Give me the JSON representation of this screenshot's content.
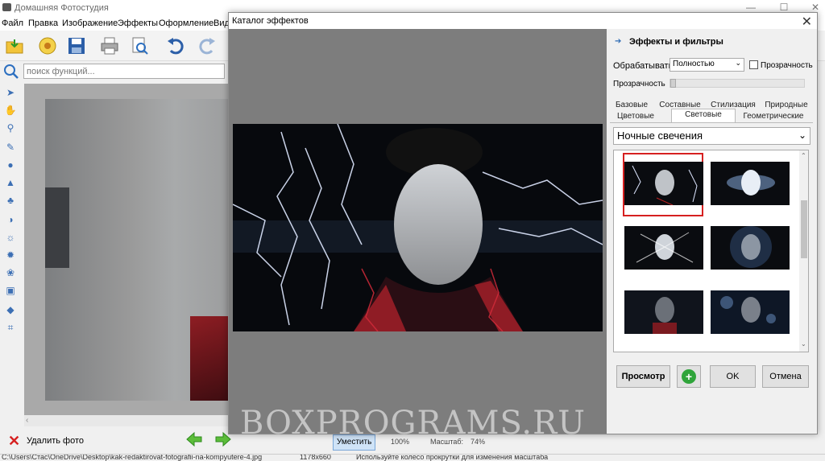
{
  "app": {
    "title": "Домашняя Фотостудия",
    "menu": [
      "Файл",
      "Правка",
      "Изображение",
      "Эффекты",
      "Оформление",
      "Вид"
    ],
    "search_placeholder": "поиск функций...",
    "delete_photo": "Удалить фото",
    "fit_label": "Уместить",
    "zoom_100": "100%",
    "scale_label": "Масштаб:",
    "scale_value": "74%"
  },
  "status": {
    "path": "C:\\Users\\Стас\\OneDrive\\Desktop\\kak-redaktirovat-fotografii-na-kompyutere-4.jpg",
    "size": "1178x660",
    "hint": "Используйте колесо прокрутки для изменения масштаба"
  },
  "dialog": {
    "title": "Каталог эффектов",
    "panel_title": "Эффекты и фильтры",
    "process_label": "Обрабатывать",
    "process_value": "Полностью",
    "transparency_checkbox": "Прозрачность",
    "transparency_slider_label": "Прозрачность",
    "tabs_row1": [
      "Базовые",
      "Составные",
      "Стилизация",
      "Природные"
    ],
    "tabs_row2": [
      "Цветовые",
      "Световые",
      "Геометрические"
    ],
    "active_tab": "Световые",
    "effect_value": "Ночные свечения",
    "preview_button": "Просмотр",
    "ok_button": "OK",
    "cancel_button": "Отмена"
  },
  "watermark": "BOXPROGRAMS.RU",
  "colors": {
    "accent_blue": "#2f6db5",
    "selection_red": "#d62020",
    "add_green": "#2fa43a"
  }
}
